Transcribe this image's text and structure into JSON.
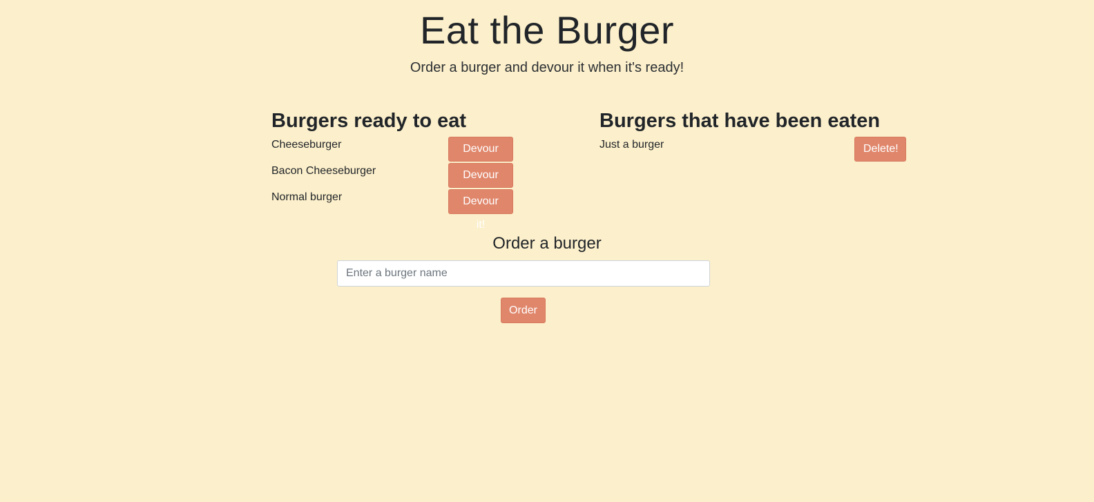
{
  "header": {
    "title": "Eat the Burger",
    "lead": "Order a burger and devour it when it's ready!"
  },
  "ready": {
    "heading": "Burgers ready to eat",
    "items": [
      {
        "name": "Cheeseburger",
        "button": "Devour it!"
      },
      {
        "name": "Bacon Cheeseburger",
        "button": "Devour it!"
      },
      {
        "name": "Normal burger",
        "button": "Devour it!"
      }
    ]
  },
  "eaten": {
    "heading": "Burgers that have been eaten",
    "items": [
      {
        "name": "Just a burger",
        "button": "Delete!"
      }
    ]
  },
  "order": {
    "heading": "Order a burger",
    "placeholder": "Enter a burger name",
    "value": "",
    "button": "Order"
  },
  "colors": {
    "background": "#fcefcb",
    "button": "#e0866b",
    "text": "#212529"
  }
}
